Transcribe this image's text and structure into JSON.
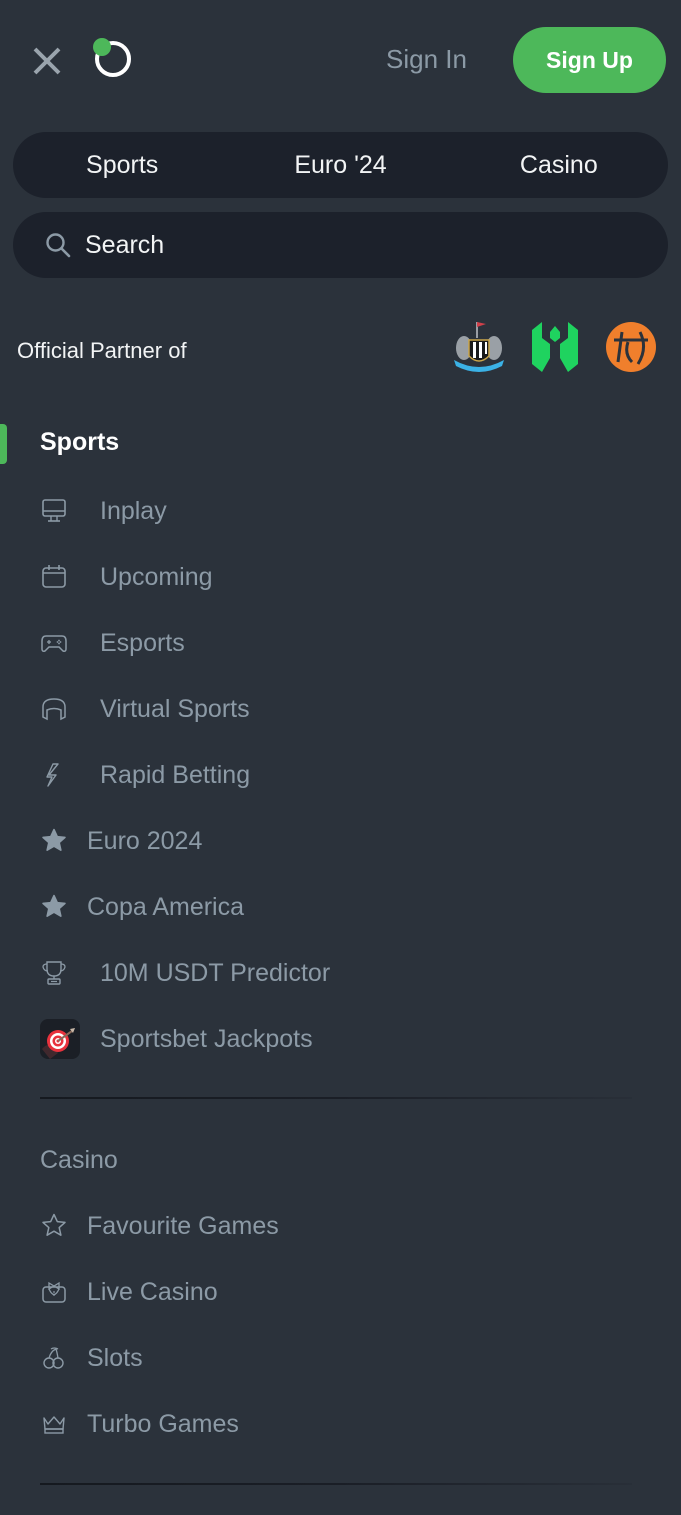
{
  "header": {
    "close_icon": "close-icon",
    "logo_icon": "brand-logo-icon",
    "sign_in_label": "Sign In",
    "sign_up_label": "Sign Up",
    "accent_color": "#4db85a"
  },
  "tabs": [
    {
      "label": "Sports"
    },
    {
      "label": "Euro '24"
    },
    {
      "label": "Casino"
    }
  ],
  "search": {
    "placeholder": "Search",
    "value": ""
  },
  "partner": {
    "label": "Official Partner of",
    "logos": [
      "newcastle-united-crest",
      "green-shield-logo",
      "orange-basketball-logo"
    ]
  },
  "sports_section": {
    "title": "Sports",
    "items": [
      {
        "label": "Inplay",
        "icon": "monitor-icon"
      },
      {
        "label": "Upcoming",
        "icon": "calendar-icon"
      },
      {
        "label": "Esports",
        "icon": "gamepad-icon"
      },
      {
        "label": "Virtual Sports",
        "icon": "headset-icon"
      },
      {
        "label": "Rapid Betting",
        "icon": "lightning-icon"
      },
      {
        "label": "Euro 2024",
        "icon": "star-filled-icon"
      },
      {
        "label": "Copa America",
        "icon": "star-filled-icon"
      },
      {
        "label": "10M USDT Predictor",
        "icon": "trophy-icon"
      },
      {
        "label": "Sportsbet Jackpots",
        "icon": "target-icon"
      }
    ]
  },
  "casino_section": {
    "title": "Casino",
    "items": [
      {
        "label": "Favourite Games",
        "icon": "star-outline-icon"
      },
      {
        "label": "Live Casino",
        "icon": "dealer-icon"
      },
      {
        "label": "Slots",
        "icon": "cherries-icon"
      },
      {
        "label": "Turbo Games",
        "icon": "crown-icon"
      }
    ]
  }
}
